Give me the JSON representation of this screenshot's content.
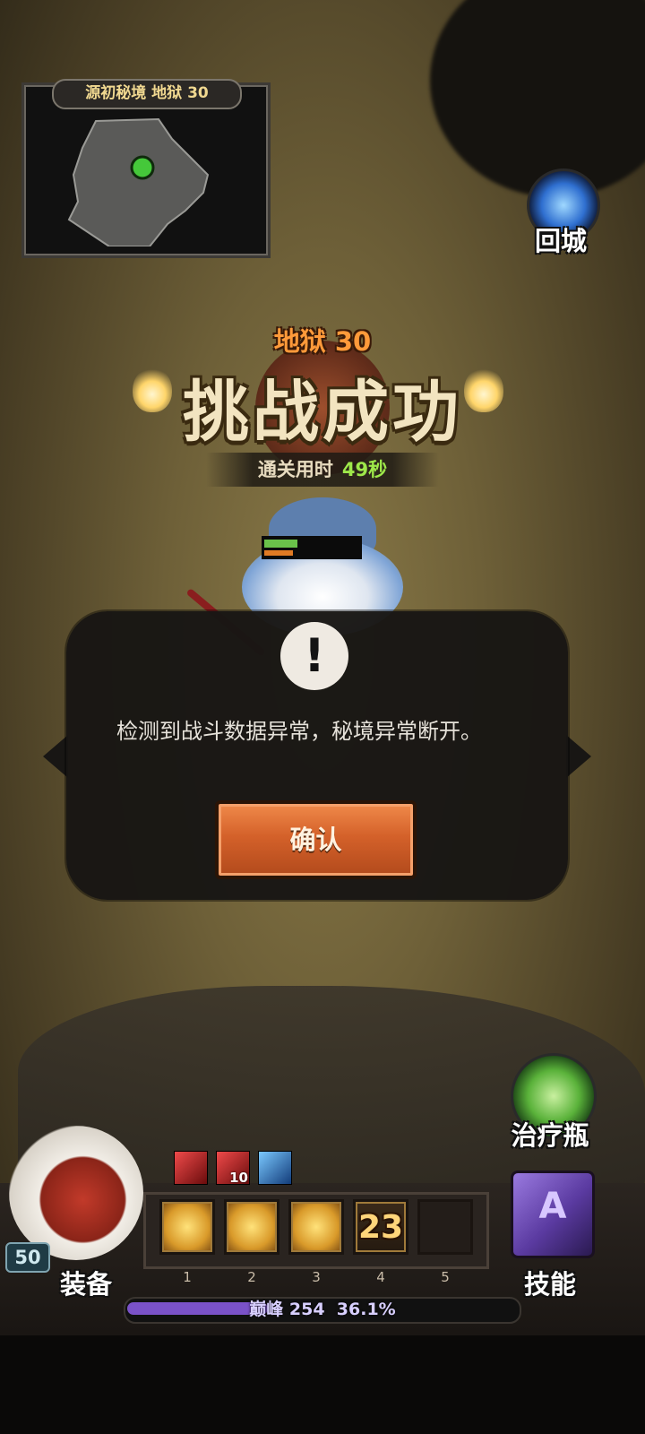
{
  "minimap": {
    "title": "源初秘境 地狱 30"
  },
  "return_button": {
    "label": "回城",
    "icon": "portal-icon"
  },
  "victory": {
    "level_label": "地狱 30",
    "title": "挑战成功",
    "time_label": "通关用时",
    "time_value": "49秒"
  },
  "hero": {
    "hp_fraction": 0.35,
    "mp_fraction": 0.3
  },
  "dialog": {
    "icon": "exclamation-icon",
    "icon_glyph": "!",
    "message": "检测到战斗数据异常，秘境异常断开。",
    "confirm_label": "确认"
  },
  "potion": {
    "label": "治疗瓶",
    "icon": "healing-potion-icon"
  },
  "skills_button": {
    "label": "技能",
    "icon": "spellbook-icon"
  },
  "equipment": {
    "label": "装备",
    "level": "50"
  },
  "buffs": [
    {
      "icon": "red-buff-icon",
      "count": ""
    },
    {
      "icon": "red-buff-icon",
      "count": "10"
    },
    {
      "icon": "blue-buff-icon",
      "count": ""
    }
  ],
  "skill_slots": [
    {
      "number": "1",
      "icon": "slash-skill-icon",
      "cooldown": ""
    },
    {
      "number": "2",
      "icon": "wind-slash-skill-icon",
      "cooldown": ""
    },
    {
      "number": "3",
      "icon": "claw-skill-icon",
      "cooldown": ""
    },
    {
      "number": "4",
      "icon": "skill-cooldown-icon",
      "cooldown": "23"
    },
    {
      "number": "5",
      "icon": "empty-slot",
      "cooldown": ""
    }
  ],
  "xp": {
    "label": "巅峰 254",
    "percent_text": "36.1%",
    "fraction": 0.361
  },
  "colors": {
    "accent": "#ff9a3a",
    "time_value": "#9ee84a",
    "confirm_button": "#d4612a",
    "xp": "#7a52c8"
  }
}
